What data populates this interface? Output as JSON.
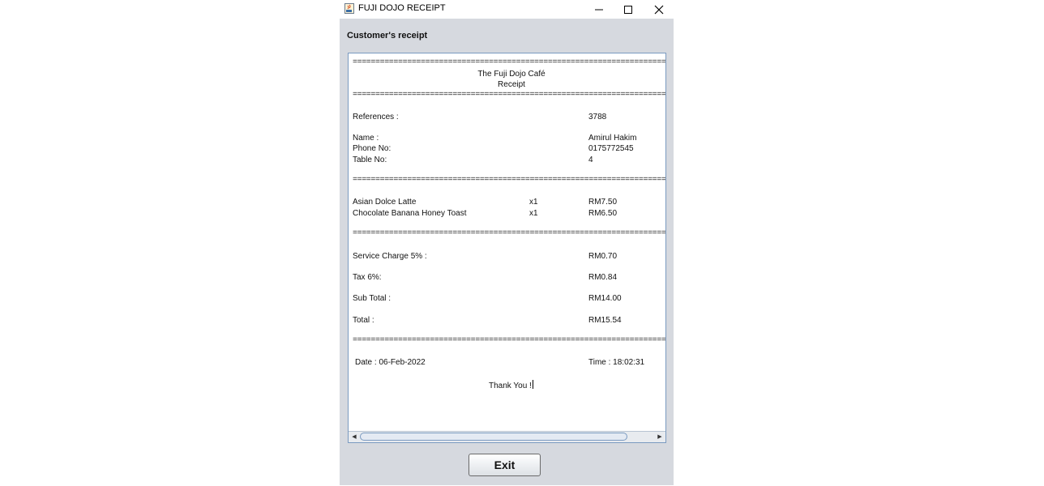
{
  "window": {
    "title": "FUJI DOJO RECEIPT",
    "heading": "Customer's receipt"
  },
  "receipt": {
    "separator": "================================================================================",
    "cafe_name": "The Fuji Dojo Café",
    "receipt_label": "Receipt",
    "reference_label": "References :",
    "reference_value": "3788",
    "name_label": "Name :",
    "name_value": "Amirul Hakim",
    "phone_label": "Phone No:",
    "phone_value": "0175772545",
    "table_label": "Table No:",
    "table_value": "4",
    "items": [
      {
        "name": "Asian Dolce Latte",
        "qty": "x1",
        "price": "RM7.50"
      },
      {
        "name": "Chocolate Banana Honey Toast",
        "qty": "x1",
        "price": "RM6.50"
      }
    ],
    "service_label": "Service Charge 5% :",
    "service_value": "RM0.70",
    "tax_label": "Tax 6%:",
    "tax_value": "RM0.84",
    "subtotal_label": "Sub Total :",
    "subtotal_value": "RM14.00",
    "total_label": "Total :",
    "total_value": "RM15.54",
    "date_text": "Date : 06-Feb-2022",
    "time_text": "Time : 18:02:31",
    "thanks": "Thank You !"
  },
  "buttons": {
    "exit_label": "Exit"
  },
  "icons": {
    "app": "java-app-icon",
    "minimize": "minimize-icon",
    "maximize": "maximize-icon",
    "close": "close-icon",
    "scroll_left": "arrow-left-icon",
    "scroll_right": "arrow-right-icon"
  },
  "colors": {
    "window_bg": "#d6d9df",
    "frame_border": "#7a9ac0"
  }
}
